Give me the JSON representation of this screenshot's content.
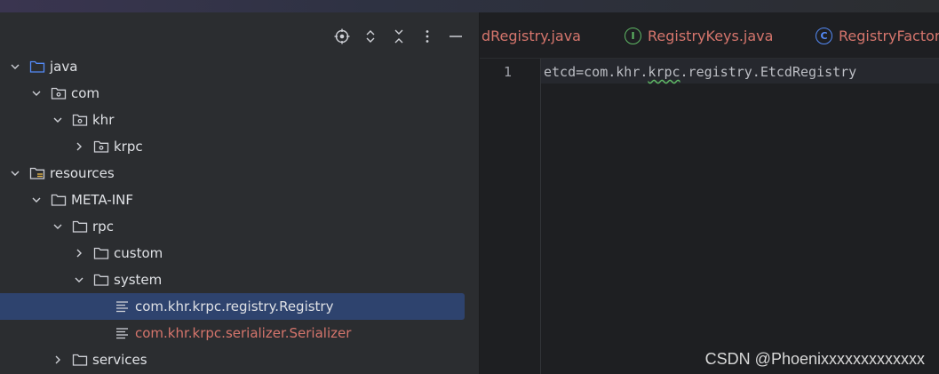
{
  "project_panel": {
    "toolbar": [
      {
        "name": "locate-icon"
      },
      {
        "name": "expand-all-icon"
      },
      {
        "name": "collapse-all-icon"
      },
      {
        "name": "more-options-icon"
      },
      {
        "name": "minimize-icon"
      }
    ],
    "tree": [
      {
        "label": "java",
        "depth": 0,
        "chevron": "down",
        "icon": "source-folder",
        "name": "tree-item-java"
      },
      {
        "label": "com",
        "depth": 1,
        "chevron": "down",
        "icon": "package",
        "name": "tree-item-com"
      },
      {
        "label": "khr",
        "depth": 2,
        "chevron": "down",
        "icon": "package",
        "name": "tree-item-khr"
      },
      {
        "label": "krpc",
        "depth": 3,
        "chevron": "right",
        "icon": "package",
        "name": "tree-item-krpc"
      },
      {
        "label": "resources",
        "depth": 0,
        "chevron": "down",
        "icon": "resources-folder",
        "name": "tree-item-resources"
      },
      {
        "label": "META-INF",
        "depth": 1,
        "chevron": "down",
        "icon": "folder",
        "name": "tree-item-meta-inf"
      },
      {
        "label": "rpc",
        "depth": 2,
        "chevron": "down",
        "icon": "folder",
        "name": "tree-item-rpc"
      },
      {
        "label": "custom",
        "depth": 3,
        "chevron": "right",
        "icon": "folder",
        "name": "tree-item-custom"
      },
      {
        "label": "system",
        "depth": 3,
        "chevron": "down",
        "icon": "folder",
        "name": "tree-item-system"
      },
      {
        "label": "com.khr.krpc.registry.Registry",
        "depth": 4,
        "chevron": "none",
        "icon": "text-file",
        "selected": true,
        "name": "tree-item-registry-file"
      },
      {
        "label": "com.khr.krpc.serializer.Serializer",
        "depth": 4,
        "chevron": "none",
        "icon": "text-file",
        "color": "#d5756c",
        "name": "tree-item-serializer-file"
      },
      {
        "label": "services",
        "depth": 2,
        "chevron": "right",
        "icon": "folder",
        "name": "tree-item-services"
      }
    ]
  },
  "editor": {
    "tabs": [
      {
        "label": "dRegistry.java",
        "icon": "",
        "name": "tab-etcd-registry"
      },
      {
        "label": "RegistryKeys.java",
        "icon": "interface",
        "icon_glyph": "I",
        "name": "tab-registry-keys"
      },
      {
        "label": "RegistryFactory",
        "icon": "class",
        "icon_glyph": "C",
        "name": "tab-registry-factory"
      }
    ],
    "line_number": "1",
    "code": {
      "before": "etcd=com.khr.",
      "typo": "krpc",
      "after": ".registry.EtcdRegistry"
    }
  },
  "watermark": "CSDN @Phoenixxxxxxxxxxxxx",
  "colors": {
    "accent_selection": "#2e436e",
    "error_red": "#d5756c",
    "interface_green": "#5fb865",
    "class_blue": "#548af7"
  }
}
